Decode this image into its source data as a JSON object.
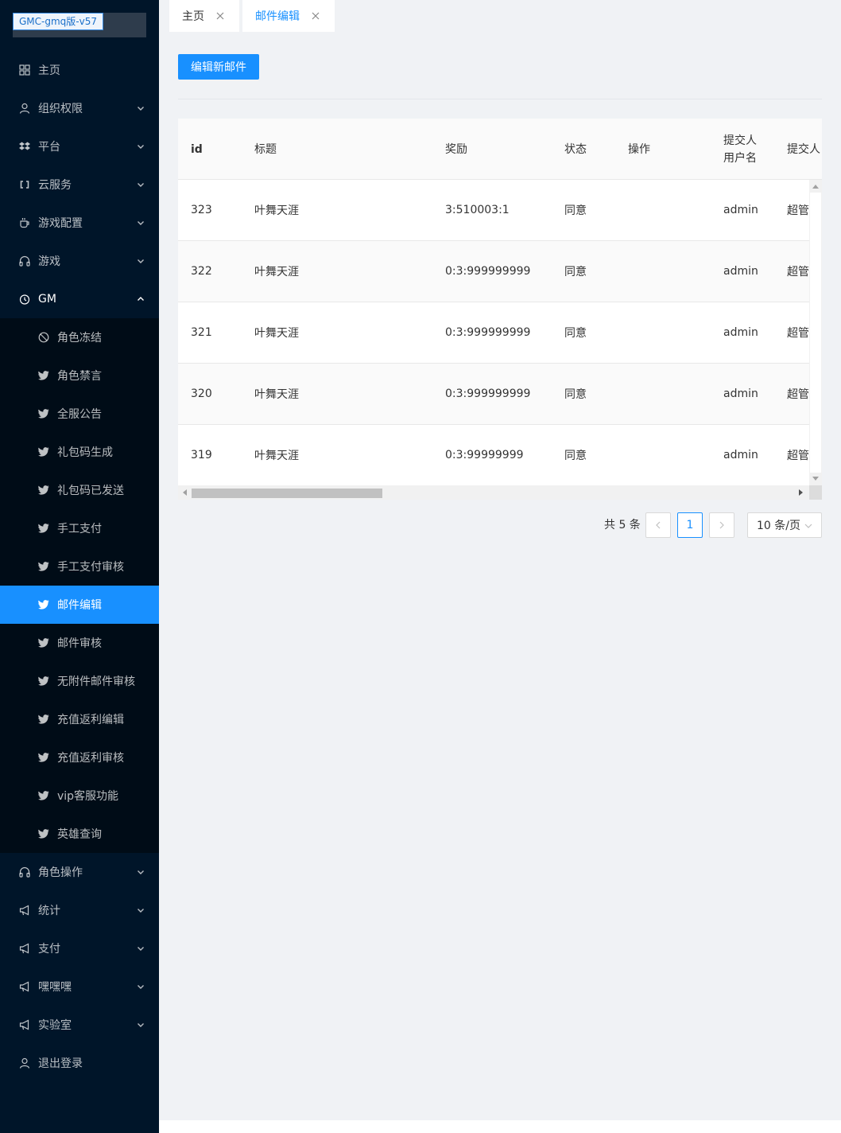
{
  "app": {
    "logo_text": "GMC-gmq版-v57"
  },
  "sidebar": {
    "top_items": [
      {
        "label": "主页",
        "icon": "appstore-icon",
        "has_arrow": false
      },
      {
        "label": "组织权限",
        "icon": "user-icon",
        "has_arrow": true
      },
      {
        "label": "平台",
        "icon": "dropbox-icon",
        "has_arrow": true
      },
      {
        "label": "云服务",
        "icon": "link-icon",
        "has_arrow": true
      },
      {
        "label": "游戏配置",
        "icon": "coffee-icon",
        "has_arrow": true
      },
      {
        "label": "游戏",
        "icon": "headphones-icon",
        "has_arrow": true
      },
      {
        "label": "GM",
        "icon": "clock-icon",
        "has_arrow": true,
        "expanded": true
      }
    ],
    "gm_submenu": [
      {
        "label": "角色冻结",
        "icon": "stop-icon"
      },
      {
        "label": "角色禁言",
        "icon": "twitter-icon"
      },
      {
        "label": "全服公告",
        "icon": "twitter-icon"
      },
      {
        "label": "礼包码生成",
        "icon": "twitter-icon"
      },
      {
        "label": "礼包码已发送",
        "icon": "twitter-icon"
      },
      {
        "label": "手工支付",
        "icon": "twitter-icon"
      },
      {
        "label": "手工支付审核",
        "icon": "twitter-icon"
      },
      {
        "label": "邮件编辑",
        "icon": "twitter-icon",
        "active": true
      },
      {
        "label": "邮件审核",
        "icon": "twitter-icon"
      },
      {
        "label": "无附件邮件审核",
        "icon": "twitter-icon"
      },
      {
        "label": "充值返利编辑",
        "icon": "twitter-icon"
      },
      {
        "label": "充值返利审核",
        "icon": "twitter-icon"
      },
      {
        "label": "vip客服功能",
        "icon": "twitter-icon"
      },
      {
        "label": "英雄查询",
        "icon": "twitter-icon"
      }
    ],
    "bottom_items": [
      {
        "label": "角色操作",
        "icon": "headphones-icon",
        "has_arrow": true
      },
      {
        "label": "统计",
        "icon": "notification-icon",
        "has_arrow": true
      },
      {
        "label": "支付",
        "icon": "notification-icon",
        "has_arrow": true
      },
      {
        "label": "嘿嘿嘿",
        "icon": "notification-icon",
        "has_arrow": true
      },
      {
        "label": "实验室",
        "icon": "notification-icon",
        "has_arrow": true
      },
      {
        "label": "退出登录",
        "icon": "user-icon",
        "has_arrow": false
      }
    ]
  },
  "tabs": [
    {
      "label": "主页",
      "active": false
    },
    {
      "label": "邮件编辑",
      "active": true
    }
  ],
  "toolbar": {
    "new_mail_label": "编辑新邮件"
  },
  "table": {
    "columns": {
      "id": "id",
      "title": "标题",
      "reward": "奖励",
      "status": "状态",
      "action": "操作",
      "submitter_user_line1": "提交人",
      "submitter_user_line2": "用户名",
      "submitter_name": "提交人"
    },
    "rows": [
      {
        "id": "323",
        "title": "叶舞天涯",
        "reward": "3:510003:1",
        "status": "同意",
        "action": "",
        "submitter_user": "admin",
        "submitter_name": "超管"
      },
      {
        "id": "322",
        "title": "叶舞天涯",
        "reward": "0:3:999999999",
        "status": "同意",
        "action": "",
        "submitter_user": "admin",
        "submitter_name": "超管"
      },
      {
        "id": "321",
        "title": "叶舞天涯",
        "reward": "0:3:999999999",
        "status": "同意",
        "action": "",
        "submitter_user": "admin",
        "submitter_name": "超管"
      },
      {
        "id": "320",
        "title": "叶舞天涯",
        "reward": "0:3:999999999",
        "status": "同意",
        "action": "",
        "submitter_user": "admin",
        "submitter_name": "超管"
      },
      {
        "id": "319",
        "title": "叶舞天涯",
        "reward": "0:3:99999999",
        "status": "同意",
        "action": "",
        "submitter_user": "admin",
        "submitter_name": "超管"
      }
    ]
  },
  "pagination": {
    "total_text": "共 5 条",
    "current_page": "1",
    "page_size_label": "10 条/页"
  },
  "colors": {
    "sidebar_bg": "#001529",
    "submenu_bg": "#000c17",
    "accent": "#1890ff"
  }
}
